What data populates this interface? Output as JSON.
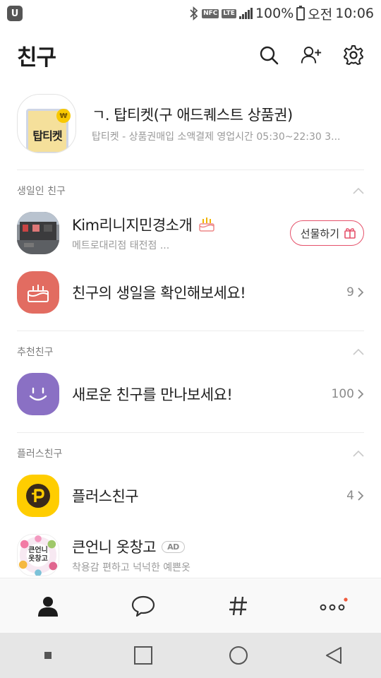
{
  "status_bar": {
    "app_icon": "U",
    "nfc": "NFC",
    "lte": "LTE",
    "battery_percent": "100%",
    "am_pm": "오전",
    "time": "10:06"
  },
  "header": {
    "title": "친구",
    "icons": [
      "search-icon",
      "add-friend-icon",
      "settings-icon"
    ]
  },
  "profile": {
    "image_label": "탑티켓",
    "coin": "₩",
    "name": "ㄱ. 탑티켓(구 애드퀘스트 상품권)",
    "status": "탑티켓 - 상품권매입 소액결제 영업시간 05:30~22:30 3..."
  },
  "birthday": {
    "section_title": "생일인 친구",
    "friend": {
      "name": "Kim리니지민경소개",
      "subtitle": "메트로대리점 태전점 ...",
      "gift_label": "선물하기"
    },
    "check": {
      "label": "친구의 생일을 확인해보세요!",
      "count": "9"
    }
  },
  "recommend": {
    "section_title": "추천친구",
    "label": "새로운 친구를 만나보세요!",
    "count": "100"
  },
  "plus": {
    "section_title": "플러스친구",
    "plus_row": {
      "label": "플러스친구",
      "count": "4"
    },
    "ad_row": {
      "name": "큰언니 옷창고",
      "ad_label": "AD",
      "subtitle": "착용감 편하고 넉넉한 예쁜옷",
      "avatar_text_1": "큰언니",
      "avatar_text_2": "옷창고"
    }
  },
  "tabs": [
    "friends-tab",
    "chats-tab",
    "hashtag-tab",
    "more-tab"
  ],
  "colors": {
    "accent_red": "#e5516a",
    "birthday_avatar": "#e26c61",
    "recommend_avatar": "#8a70c4",
    "plus_yellow": "#ffcd00",
    "notification_dot": "#ef5a3c"
  }
}
